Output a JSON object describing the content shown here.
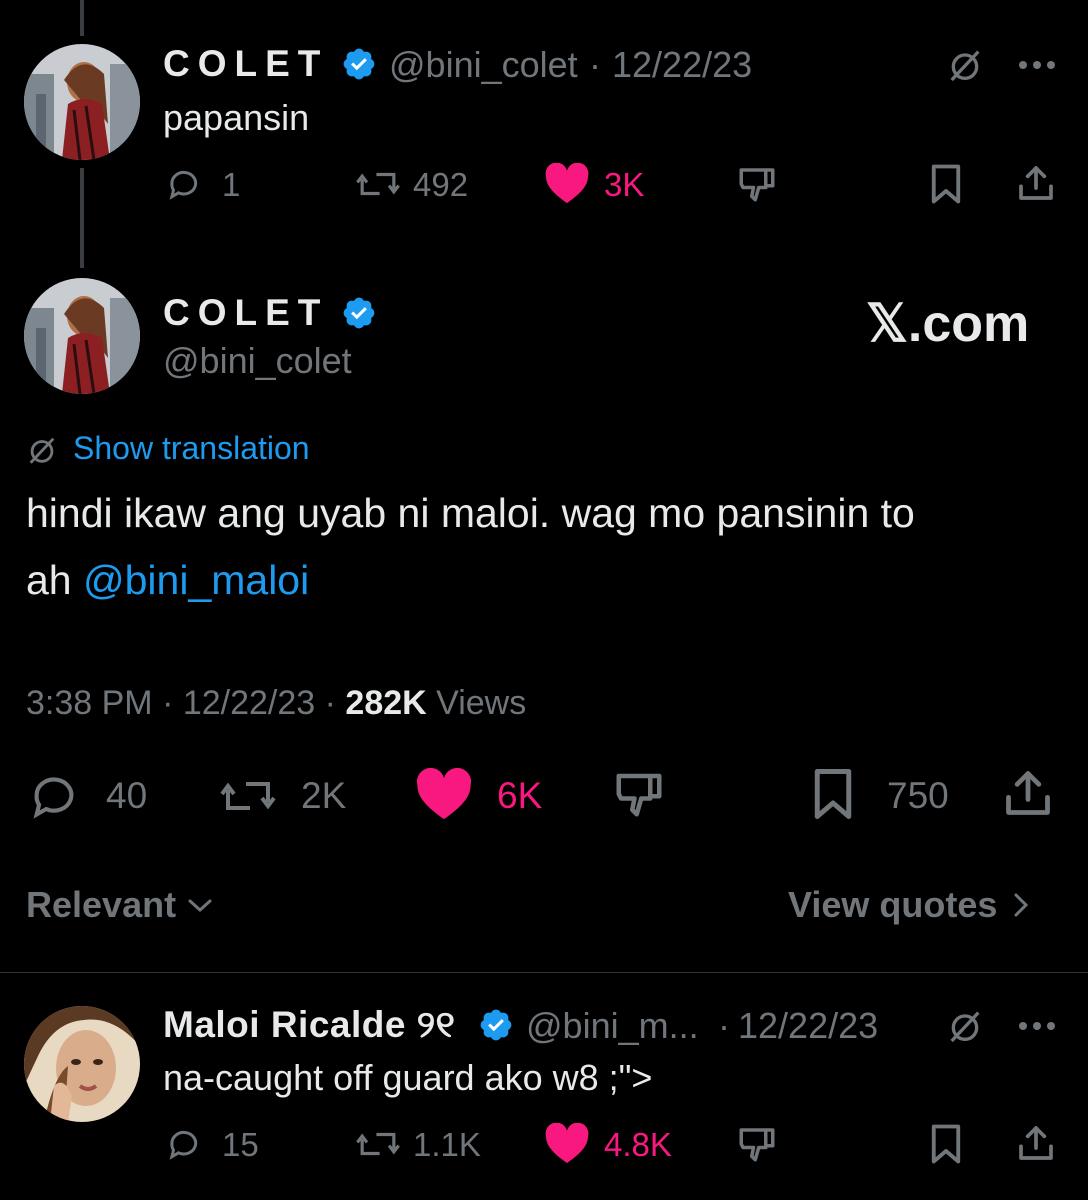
{
  "colors": {
    "background": "#000000",
    "text": "#e7e9ea",
    "muted": "#71767b",
    "link": "#1d9bf0",
    "like": "#f91880",
    "verified": "#1d9bf0"
  },
  "reply_above": {
    "name": "COLET",
    "handle": "@bini_colet",
    "date": "12/22/23",
    "text": "papansin",
    "replies": "1",
    "reposts": "492",
    "likes": "3K"
  },
  "main_tweet": {
    "name": "COLET",
    "handle": "@bini_colet",
    "watermark": "𝕏.com",
    "translate_label": "Show translation",
    "text_line1": "hindi ikaw ang uyab ni maloi. wag mo pansinin to",
    "text_line2_prefix": "ah ",
    "mention": "@bini_maloi",
    "time": "3:38 PM",
    "date": "12/22/23",
    "views_count": "282K",
    "views_label": "Views",
    "replies": "40",
    "reposts": "2K",
    "likes": "6K",
    "bookmarks": "750"
  },
  "sort": {
    "label": "Relevant",
    "quotes_label": "View quotes"
  },
  "reply_below": {
    "name": "Maloi Ricalde ୨୧",
    "handle": "@bini_m...",
    "date": "12/22/23",
    "text": "na-caught off guard ako w8 ;\">",
    "replies": "15",
    "reposts": "1.1K",
    "likes": "4.8K"
  },
  "icons": [
    "reply-icon",
    "repost-icon",
    "heart-icon",
    "dislike-icon",
    "bookmark-icon",
    "share-icon",
    "translate-icon",
    "more-icon",
    "verified-icon",
    "chevron-down-icon",
    "chevron-right-icon"
  ]
}
